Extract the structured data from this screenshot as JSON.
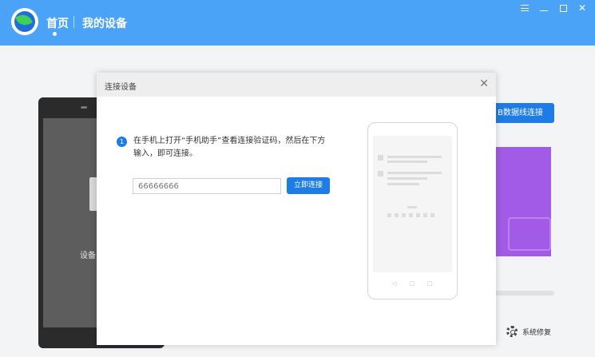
{
  "header": {
    "nav_home": "首页",
    "nav_devices": "我的设备",
    "window_controls": [
      "menu-icon",
      "minimize-icon",
      "maximize-icon",
      "close-icon"
    ]
  },
  "background": {
    "device_label": "设备",
    "usb_connect_label": "B数据线连接",
    "repair_label": "系统修复"
  },
  "dialog": {
    "title": "连接设备",
    "close_glyph": "✕",
    "step_number": "1",
    "instruction": "在手机上打开“手机助手”查看连接验证码，然后在下方输入，即可连接。",
    "code_input_placeholder": "66666666",
    "connect_button": "立即连接"
  },
  "colors": {
    "header": "#4aa3f7",
    "accent": "#1e7ce6",
    "promo": "#a15be6"
  }
}
